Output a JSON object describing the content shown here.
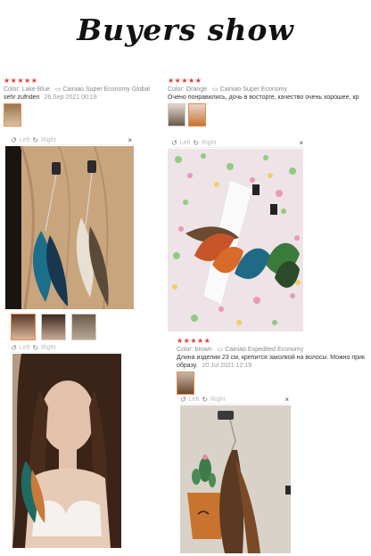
{
  "title": "Buyers show",
  "review_left": {
    "stars": "★★★★★",
    "color_label": "Color:",
    "color_value": "Lake Blue",
    "ship_icon": "truck-icon",
    "shipping": "Cainiao Super Economy Global",
    "text": "sehr zufriden",
    "date": "26 Sep 2021 00:19"
  },
  "review_right": {
    "stars": "★★★★★",
    "color_label": "Color:",
    "color_value": "Orange",
    "ship_icon": "truck-icon",
    "shipping": "Cainiao Super Economy",
    "text": "Очено понравились, дочь в восторге, качество очень хорошее, кр"
  },
  "review_bottom": {
    "stars": "★★★★★",
    "color_label": "Color:",
    "color_value": "brown",
    "ship_icon": "truck-icon",
    "shipping": "Cainiao Expedited Economy",
    "text_line1": "Длина изделия 23 см, крепится заколкой на волосы. Можно прик",
    "text_line2": "образу.",
    "date": "20 Jul 2021 12:19"
  },
  "viewer": {
    "left_label": "Left",
    "right_label": "Right",
    "close": "×"
  }
}
